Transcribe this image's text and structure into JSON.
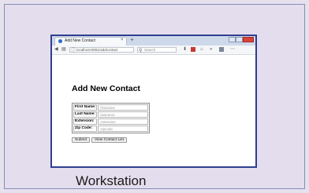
{
  "caption": "Workstation",
  "browser": {
    "tab_title": "Add New Contact",
    "tab_close": "×",
    "new_tab": "+",
    "url": "localhost:8081/addcontact",
    "search_placeholder": "Search"
  },
  "page": {
    "title": "Add New Contact",
    "fields": [
      {
        "label": "First Name:",
        "placeholder": "firstname"
      },
      {
        "label": "Last Name:",
        "placeholder": "lastname"
      },
      {
        "label": "Extension:",
        "placeholder": "extension"
      },
      {
        "label": "Zip Code:",
        "placeholder": "zipcode"
      }
    ],
    "submit_label": "Submit",
    "view_list_label": "View Contact List"
  },
  "colors": {
    "background": "#e7e1ee",
    "frame_border": "#2f3f8f",
    "close_button": "#d9423a"
  }
}
